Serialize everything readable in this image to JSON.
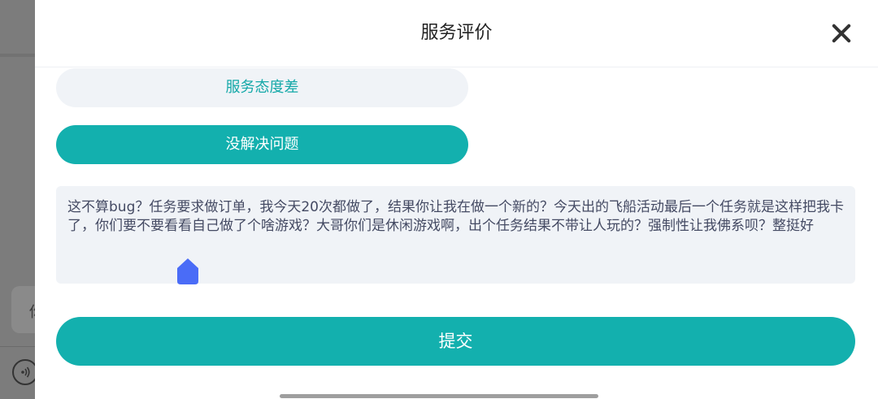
{
  "background": {
    "glyph": "你"
  },
  "dialog": {
    "title": "服务评价",
    "close_icon": "close-icon"
  },
  "options": [
    {
      "label": "服务态度差",
      "selected": false
    },
    {
      "label": "没解决问题",
      "selected": true
    }
  ],
  "feedback": {
    "text": "这不算bug？任务要求做订单，我今天20次都做了，结果你让我在做一个新的？今天出的飞船活动最后一个任务就是这样把我卡了，你们要不要看看自己做了个啥游戏？大哥你们是休闲游戏啊，出个任务结果不带让人玩的？强制性让我佛系呗？整挺好"
  },
  "submit_label": "提交",
  "colors": {
    "accent": "#13b0ae",
    "option_bg": "#f0f3f7",
    "caret": "#4a6cf7"
  }
}
